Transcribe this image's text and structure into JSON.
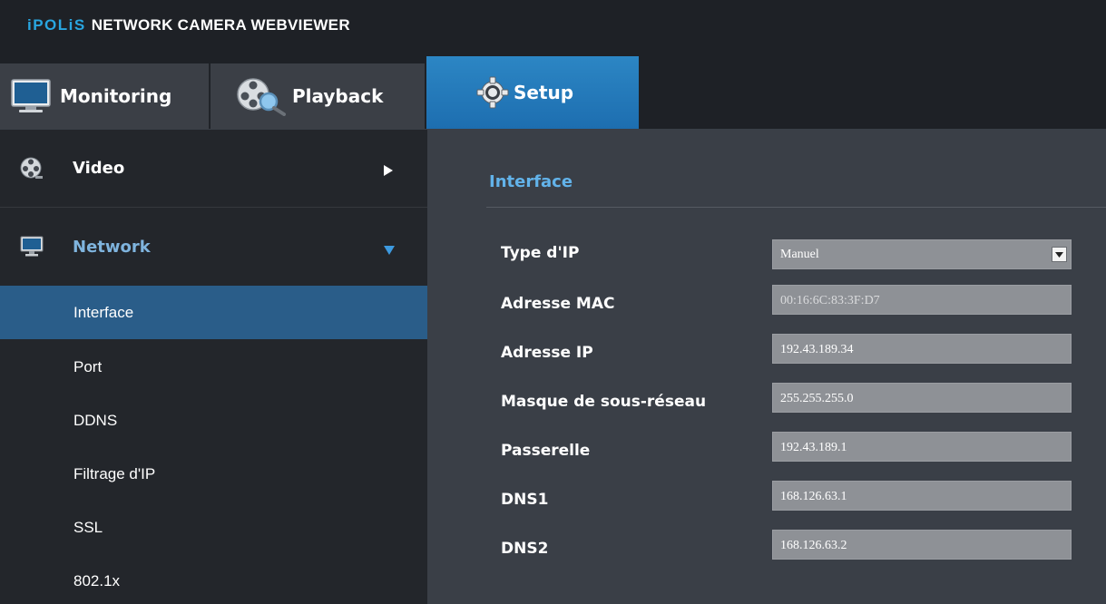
{
  "app": {
    "brand": "iPOLiS",
    "title": "NETWORK CAMERA WEBVIEWER"
  },
  "tabs": [
    {
      "label": "Monitoring",
      "icon": "monitor-icon",
      "active": false
    },
    {
      "label": "Playback",
      "icon": "film-reel-search-icon",
      "active": false
    },
    {
      "label": "Setup",
      "icon": "gear-icon",
      "active": true
    }
  ],
  "sidebar": {
    "groups": [
      {
        "label": "Video",
        "icon": "film-reel-icon",
        "arrow": "right",
        "expanded": false
      },
      {
        "label": "Network",
        "icon": "monitor-icon",
        "arrow": "down",
        "expanded": true
      }
    ],
    "items": [
      {
        "label": "Interface",
        "active": true
      },
      {
        "label": "Port",
        "active": false
      },
      {
        "label": "DDNS",
        "active": false
      },
      {
        "label": "Filtrage d'IP",
        "active": false
      },
      {
        "label": "SSL",
        "active": false
      },
      {
        "label": "802.1x",
        "active": false
      }
    ]
  },
  "main": {
    "section_title": "Interface",
    "fields": [
      {
        "label": "Type d'IP",
        "value": "Manuel",
        "kind": "select"
      },
      {
        "label": "Adresse MAC",
        "value": "00:16:6C:83:3F:D7",
        "kind": "readonly"
      },
      {
        "label": "Adresse IP",
        "value": "192.43.189.34",
        "kind": "text"
      },
      {
        "label": "Masque de sous-réseau",
        "value": "255.255.255.0",
        "kind": "text"
      },
      {
        "label": "Passerelle",
        "value": "192.43.189.1",
        "kind": "text"
      },
      {
        "label": "DNS1",
        "value": "168.126.63.1",
        "kind": "text"
      },
      {
        "label": "DNS2",
        "value": "168.126.63.2",
        "kind": "text"
      }
    ]
  },
  "colors": {
    "accent": "#29a6e0",
    "active_tab": "#1d6eb0",
    "sidebar_active": "#2a5d89",
    "section_title": "#62b3ea"
  }
}
